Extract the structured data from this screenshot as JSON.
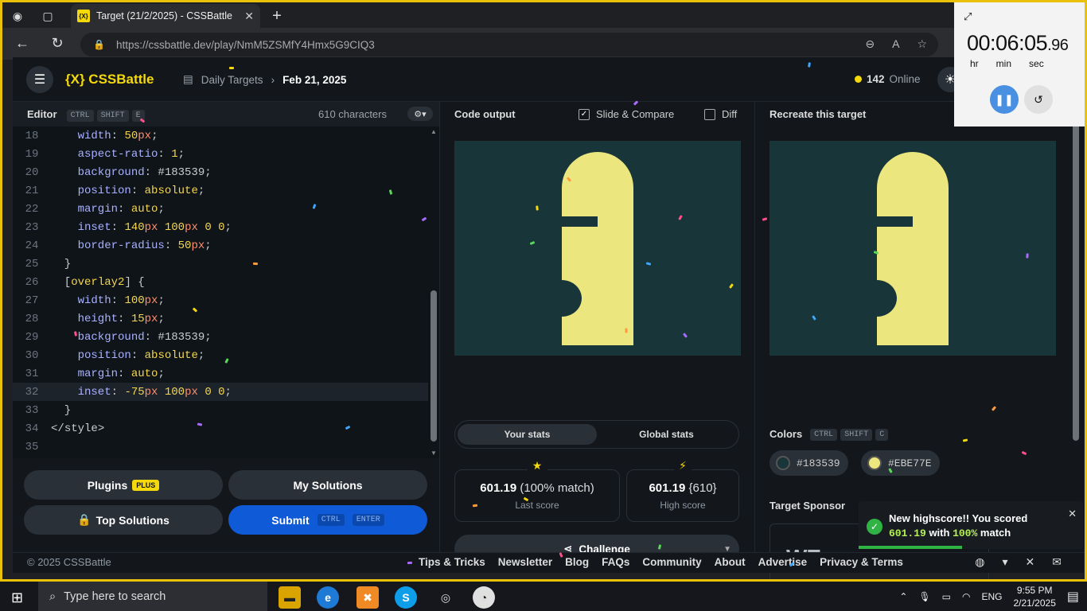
{
  "browser": {
    "tab_title": "Target (21/2/2025) - CSSBattle",
    "favicon_text": "{X}",
    "url": "https://cssbattle.dev/play/NmM5ZSMfY4Hmx5G9CIQ3"
  },
  "header": {
    "logo": "{X} CSSBattle",
    "breadcrumb_section": "Daily Targets",
    "breadcrumb_current": "Feb 21, 2025",
    "online_count": "142",
    "online_label": "Online"
  },
  "editor": {
    "title": "Editor",
    "shortcut": [
      "CTRL",
      "SHIFT",
      "E"
    ],
    "chars": "610 characters",
    "lines": [
      {
        "n": "18",
        "tokens": [
          [
            "k",
            "    width"
          ],
          [
            "h",
            ": "
          ],
          [
            "v",
            "50"
          ],
          [
            "u",
            "px"
          ],
          [
            "h",
            ";"
          ]
        ]
      },
      {
        "n": "19",
        "tokens": [
          [
            "k",
            "    aspect-ratio"
          ],
          [
            "h",
            ": "
          ],
          [
            "v",
            "1"
          ],
          [
            "h",
            ";"
          ]
        ]
      },
      {
        "n": "20",
        "tokens": [
          [
            "k",
            "    background"
          ],
          [
            "h",
            ": #183539;"
          ]
        ]
      },
      {
        "n": "21",
        "tokens": [
          [
            "k",
            "    position"
          ],
          [
            "h",
            ": "
          ],
          [
            "v",
            "absolute"
          ],
          [
            "h",
            ";"
          ]
        ]
      },
      {
        "n": "22",
        "tokens": [
          [
            "k",
            "    margin"
          ],
          [
            "h",
            ": "
          ],
          [
            "v",
            "auto"
          ],
          [
            "h",
            ";"
          ]
        ]
      },
      {
        "n": "23",
        "tokens": [
          [
            "k",
            "    inset"
          ],
          [
            "h",
            ": "
          ],
          [
            "v",
            "140"
          ],
          [
            "u",
            "px "
          ],
          [
            "v",
            "100"
          ],
          [
            "u",
            "px "
          ],
          [
            "v",
            "0 0"
          ],
          [
            "h",
            ";"
          ]
        ]
      },
      {
        "n": "24",
        "tokens": [
          [
            "k",
            "    border-radius"
          ],
          [
            "h",
            ": "
          ],
          [
            "v",
            "50"
          ],
          [
            "u",
            "px"
          ],
          [
            "h",
            ";"
          ]
        ]
      },
      {
        "n": "25",
        "tokens": [
          [
            "h",
            "  }"
          ]
        ]
      },
      {
        "n": "26",
        "tokens": [
          [
            "h",
            "  ["
          ],
          [
            "v",
            "overlay2"
          ],
          [
            "h",
            "] {"
          ]
        ]
      },
      {
        "n": "27",
        "tokens": [
          [
            "k",
            "    width"
          ],
          [
            "h",
            ": "
          ],
          [
            "v",
            "100"
          ],
          [
            "u",
            "px"
          ],
          [
            "h",
            ";"
          ]
        ]
      },
      {
        "n": "28",
        "tokens": [
          [
            "k",
            "    height"
          ],
          [
            "h",
            ": "
          ],
          [
            "v",
            "15"
          ],
          [
            "u",
            "px"
          ],
          [
            "h",
            ";"
          ]
        ]
      },
      {
        "n": "29",
        "tokens": [
          [
            "k",
            "    background"
          ],
          [
            "h",
            ": #183539;"
          ]
        ]
      },
      {
        "n": "30",
        "tokens": [
          [
            "k",
            "    position"
          ],
          [
            "h",
            ": "
          ],
          [
            "v",
            "absolute"
          ],
          [
            "h",
            ";"
          ]
        ]
      },
      {
        "n": "31",
        "tokens": [
          [
            "k",
            "    margin"
          ],
          [
            "h",
            ": "
          ],
          [
            "v",
            "auto"
          ],
          [
            "h",
            ";"
          ]
        ]
      },
      {
        "n": "32",
        "tokens": [
          [
            "k",
            "    inset"
          ],
          [
            "h",
            ": "
          ],
          [
            "v",
            "-75"
          ],
          [
            "u",
            "px "
          ],
          [
            "v",
            "100"
          ],
          [
            "u",
            "px "
          ],
          [
            "v",
            "0 0"
          ],
          [
            "h",
            ";"
          ]
        ]
      },
      {
        "n": "33",
        "tokens": [
          [
            "h",
            "  }"
          ]
        ]
      },
      {
        "n": "34",
        "tokens": [
          [
            "h",
            "</"
          ],
          [
            "h",
            "style"
          ],
          [
            "h",
            ">"
          ]
        ]
      },
      {
        "n": "35",
        "tokens": []
      }
    ],
    "active_line": "32"
  },
  "actions": {
    "plugins": "Plugins",
    "plugins_badge": "PLUS",
    "my_solutions": "My Solutions",
    "top_solutions": "Top Solutions",
    "submit": "Submit",
    "submit_keys": [
      "CTRL",
      "ENTER"
    ]
  },
  "output": {
    "title": "Code output",
    "slide_compare": "Slide & Compare",
    "slide_compare_checked": true,
    "diff": "Diff",
    "diff_checked": false,
    "tabs": [
      "Your stats",
      "Global stats"
    ],
    "last_score": "601.19",
    "last_match": "(100% match)",
    "last_label": "Last score",
    "high_score": "601.19",
    "high_chars": "{610}",
    "high_label": "High score",
    "challenge": "Challenge"
  },
  "target": {
    "title": "Recreate this target",
    "colors_label": "Colors",
    "colors_shortcut": [
      "CTRL",
      "SHIFT",
      "C"
    ],
    "colors": [
      {
        "hex": "#183539",
        "label": "#183539"
      },
      {
        "hex": "#EBE77E",
        "label": "#EBE77E"
      }
    ],
    "sponsor_label": "Target Sponsor",
    "sponsor_logo": "WE"
  },
  "footer": {
    "copyright": "© 2025 CSSBattle",
    "links": [
      "Tips & Tricks",
      "Newsletter",
      "Blog",
      "FAQs",
      "Community",
      "About",
      "Advertise",
      "Privacy & Terms"
    ]
  },
  "toast": {
    "line1": "New highscore!! You scored",
    "score": "601.19",
    "with": "with",
    "match": "100%",
    "match_word": "match"
  },
  "timer": {
    "main": "00:06:05",
    "fraction": ".96",
    "labels": [
      "hr",
      "min",
      "sec"
    ]
  },
  "taskbar": {
    "search_placeholder": "Type here to search",
    "language": "ENG",
    "time": "9:55 PM",
    "date": "2/21/2025"
  }
}
